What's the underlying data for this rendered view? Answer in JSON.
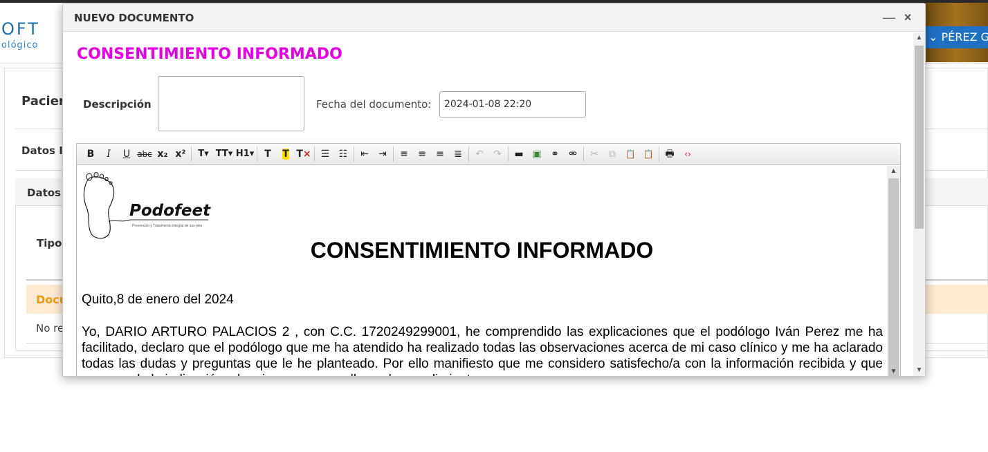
{
  "app": {
    "brand_top": "OFT",
    "brand_sub": "ológico",
    "user_name": "PÉREZ GU",
    "user_chevron": "chevron-down-icon"
  },
  "background": {
    "paciente_label": "Pacien",
    "datos_i_label": "Datos In",
    "datos_c_label": "Datos c",
    "tipo_label": "Tipo",
    "docu_label": "Docu",
    "no_records": "No re"
  },
  "modal": {
    "title": "NUEVO DOCUMENTO",
    "minimize_icon": "minimize-icon",
    "close_icon": "close-icon"
  },
  "form": {
    "heading": "CONSENTIMIENTO INFORMADO",
    "description_label": "Descripción",
    "description_value": "",
    "date_label": "Fecha del documento:",
    "date_value": "2024-01-08 22:20"
  },
  "toolbar": {
    "bold": "B",
    "italic": "I",
    "underline": "U",
    "strike": "abc",
    "subscript": "x₂",
    "superscript": "x²",
    "font": "T▾",
    "size": "TT▾",
    "heading": "H1▾",
    "text_color": "T",
    "highlight": "T",
    "erase": "T",
    "bullets": "☰",
    "numbers": "☷",
    "outdent": "⇤",
    "indent": "⇥",
    "align_left": "≡",
    "align_center": "≡",
    "align_right": "≡",
    "justify": "≣",
    "undo": "↶",
    "redo": "↷",
    "hr": "▬",
    "image": "▣",
    "link": "⚭",
    "unlink": "⚮",
    "cut": "✂",
    "copy": "⧉",
    "paste": "📋",
    "paste_text": "📋",
    "print": "🖶",
    "source": "‹›"
  },
  "document": {
    "logo_name": "Podofeet",
    "logo_tagline": "Prevención y Tratamiento integral de sus pies",
    "title": "CONSENTIMIENTO INFORMADO",
    "date_line": "Quito,8 de enero del 2024",
    "body": "Yo, DARIO ARTURO PALACIOS 2 , con C.C. 1720249299001, he comprendido las explicaciones que el podólogo Iván Perez me ha facilitado, declaro que el podólogo que me ha atendido ha realizado todas las observaciones acerca de mi caso clínico y me ha aclarado todas las dudas y preguntas que le he planteado. Por ello manifiesto que me considero satisfecho/a con la información recibida y que comprendo la indicación y los riesgos que conlleva el procedimiento."
  }
}
